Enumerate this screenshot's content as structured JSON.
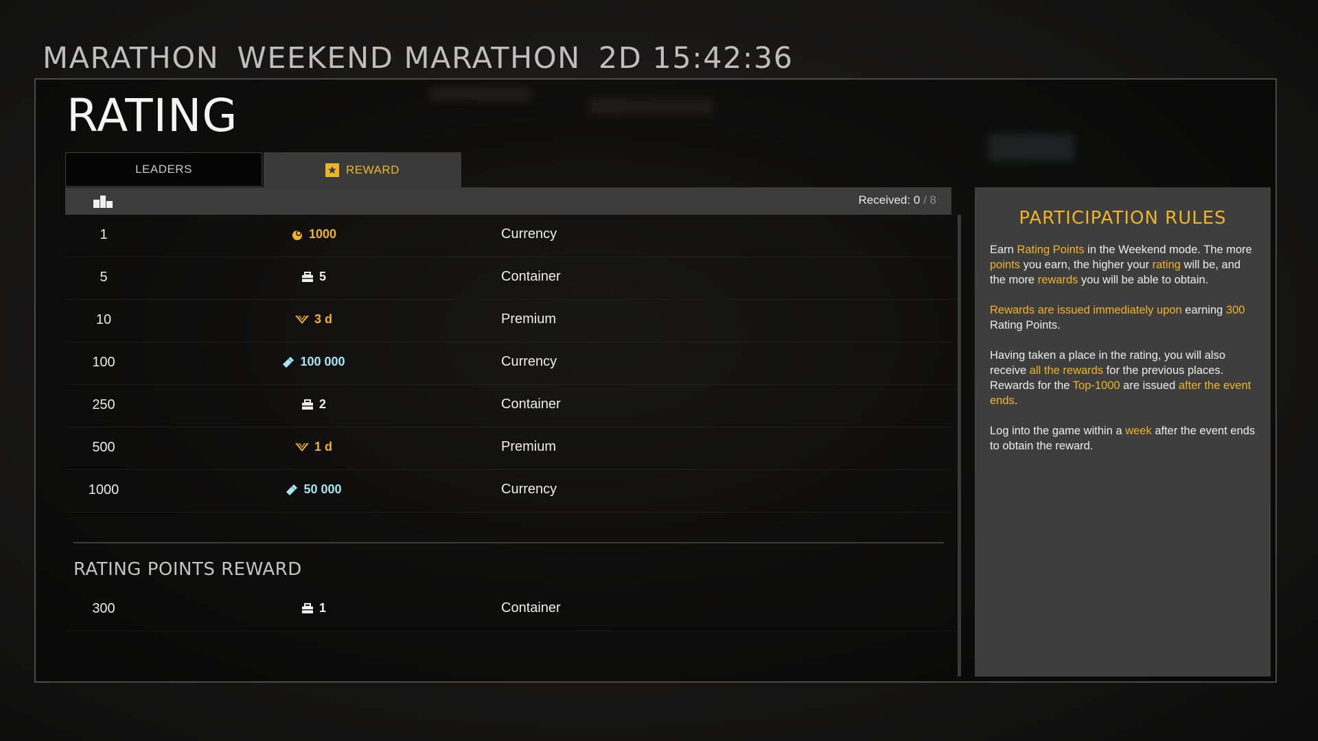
{
  "header": {
    "mode": "MARATHON",
    "event": "WEEKEND MARATHON",
    "timer": "2D 15:42:36"
  },
  "title": "RATING",
  "tabs": {
    "leaders": "LEADERS",
    "reward": "REWARD",
    "active": "reward"
  },
  "table_header": {
    "received_label": "Received:",
    "received_value": "0",
    "received_sep": "/",
    "received_total": "8"
  },
  "rewards": [
    {
      "place": "1",
      "icon": "coin-icon",
      "amount": "1000",
      "type": "Currency",
      "color": "#f0b428"
    },
    {
      "place": "5",
      "icon": "container-icon",
      "amount": "5",
      "type": "Container",
      "color": "#f0f0f0"
    },
    {
      "place": "10",
      "icon": "premium-icon",
      "amount": "3 d",
      "type": "Premium",
      "color": "#f0b428"
    },
    {
      "place": "100",
      "icon": "crystal-icon",
      "amount": "100 000",
      "type": "Currency",
      "color": "#a9e4f3"
    },
    {
      "place": "250",
      "icon": "container-icon",
      "amount": "2",
      "type": "Container",
      "color": "#f0f0f0"
    },
    {
      "place": "500",
      "icon": "premium-icon",
      "amount": "1 d",
      "type": "Premium",
      "color": "#f0b428"
    },
    {
      "place": "1000",
      "icon": "crystal-icon",
      "amount": "50 000",
      "type": "Currency",
      "color": "#a9e4f3"
    }
  ],
  "points_section": {
    "title": "RATING POINTS REWARD",
    "row": {
      "place": "300",
      "icon": "container-icon",
      "amount": "1",
      "type": "Container"
    }
  },
  "rules": {
    "title": "PARTICIPATION RULES",
    "p1": {
      "a": "Earn ",
      "b": "Rating Points",
      "c": " in the Weekend mode. The more ",
      "d": "points",
      "e": " you earn, the higher your ",
      "f": "rating",
      "g": " will be, and the more ",
      "h": "rewards",
      "i": " you will be able to obtain."
    },
    "p2": {
      "a": "Rewards are issued immediately upon",
      "b": " earning ",
      "c": "300",
      "d": " Rating Points."
    },
    "p3": {
      "a": " Having taken a place in the rating, you will also receive ",
      "b": "all the rewards",
      "c": " for the previous places. Rewards for the ",
      "d": "Top-1000",
      "e": " are issued ",
      "f": "after the event ends",
      "g": "."
    },
    "p4": {
      "a": "Log into the game within a ",
      "b": "week",
      "c": " after the event ends to obtain the reward."
    }
  },
  "colors": {
    "accent": "#f0b428",
    "crystal": "#a9e4f3",
    "panel": "#3e3e3e"
  }
}
